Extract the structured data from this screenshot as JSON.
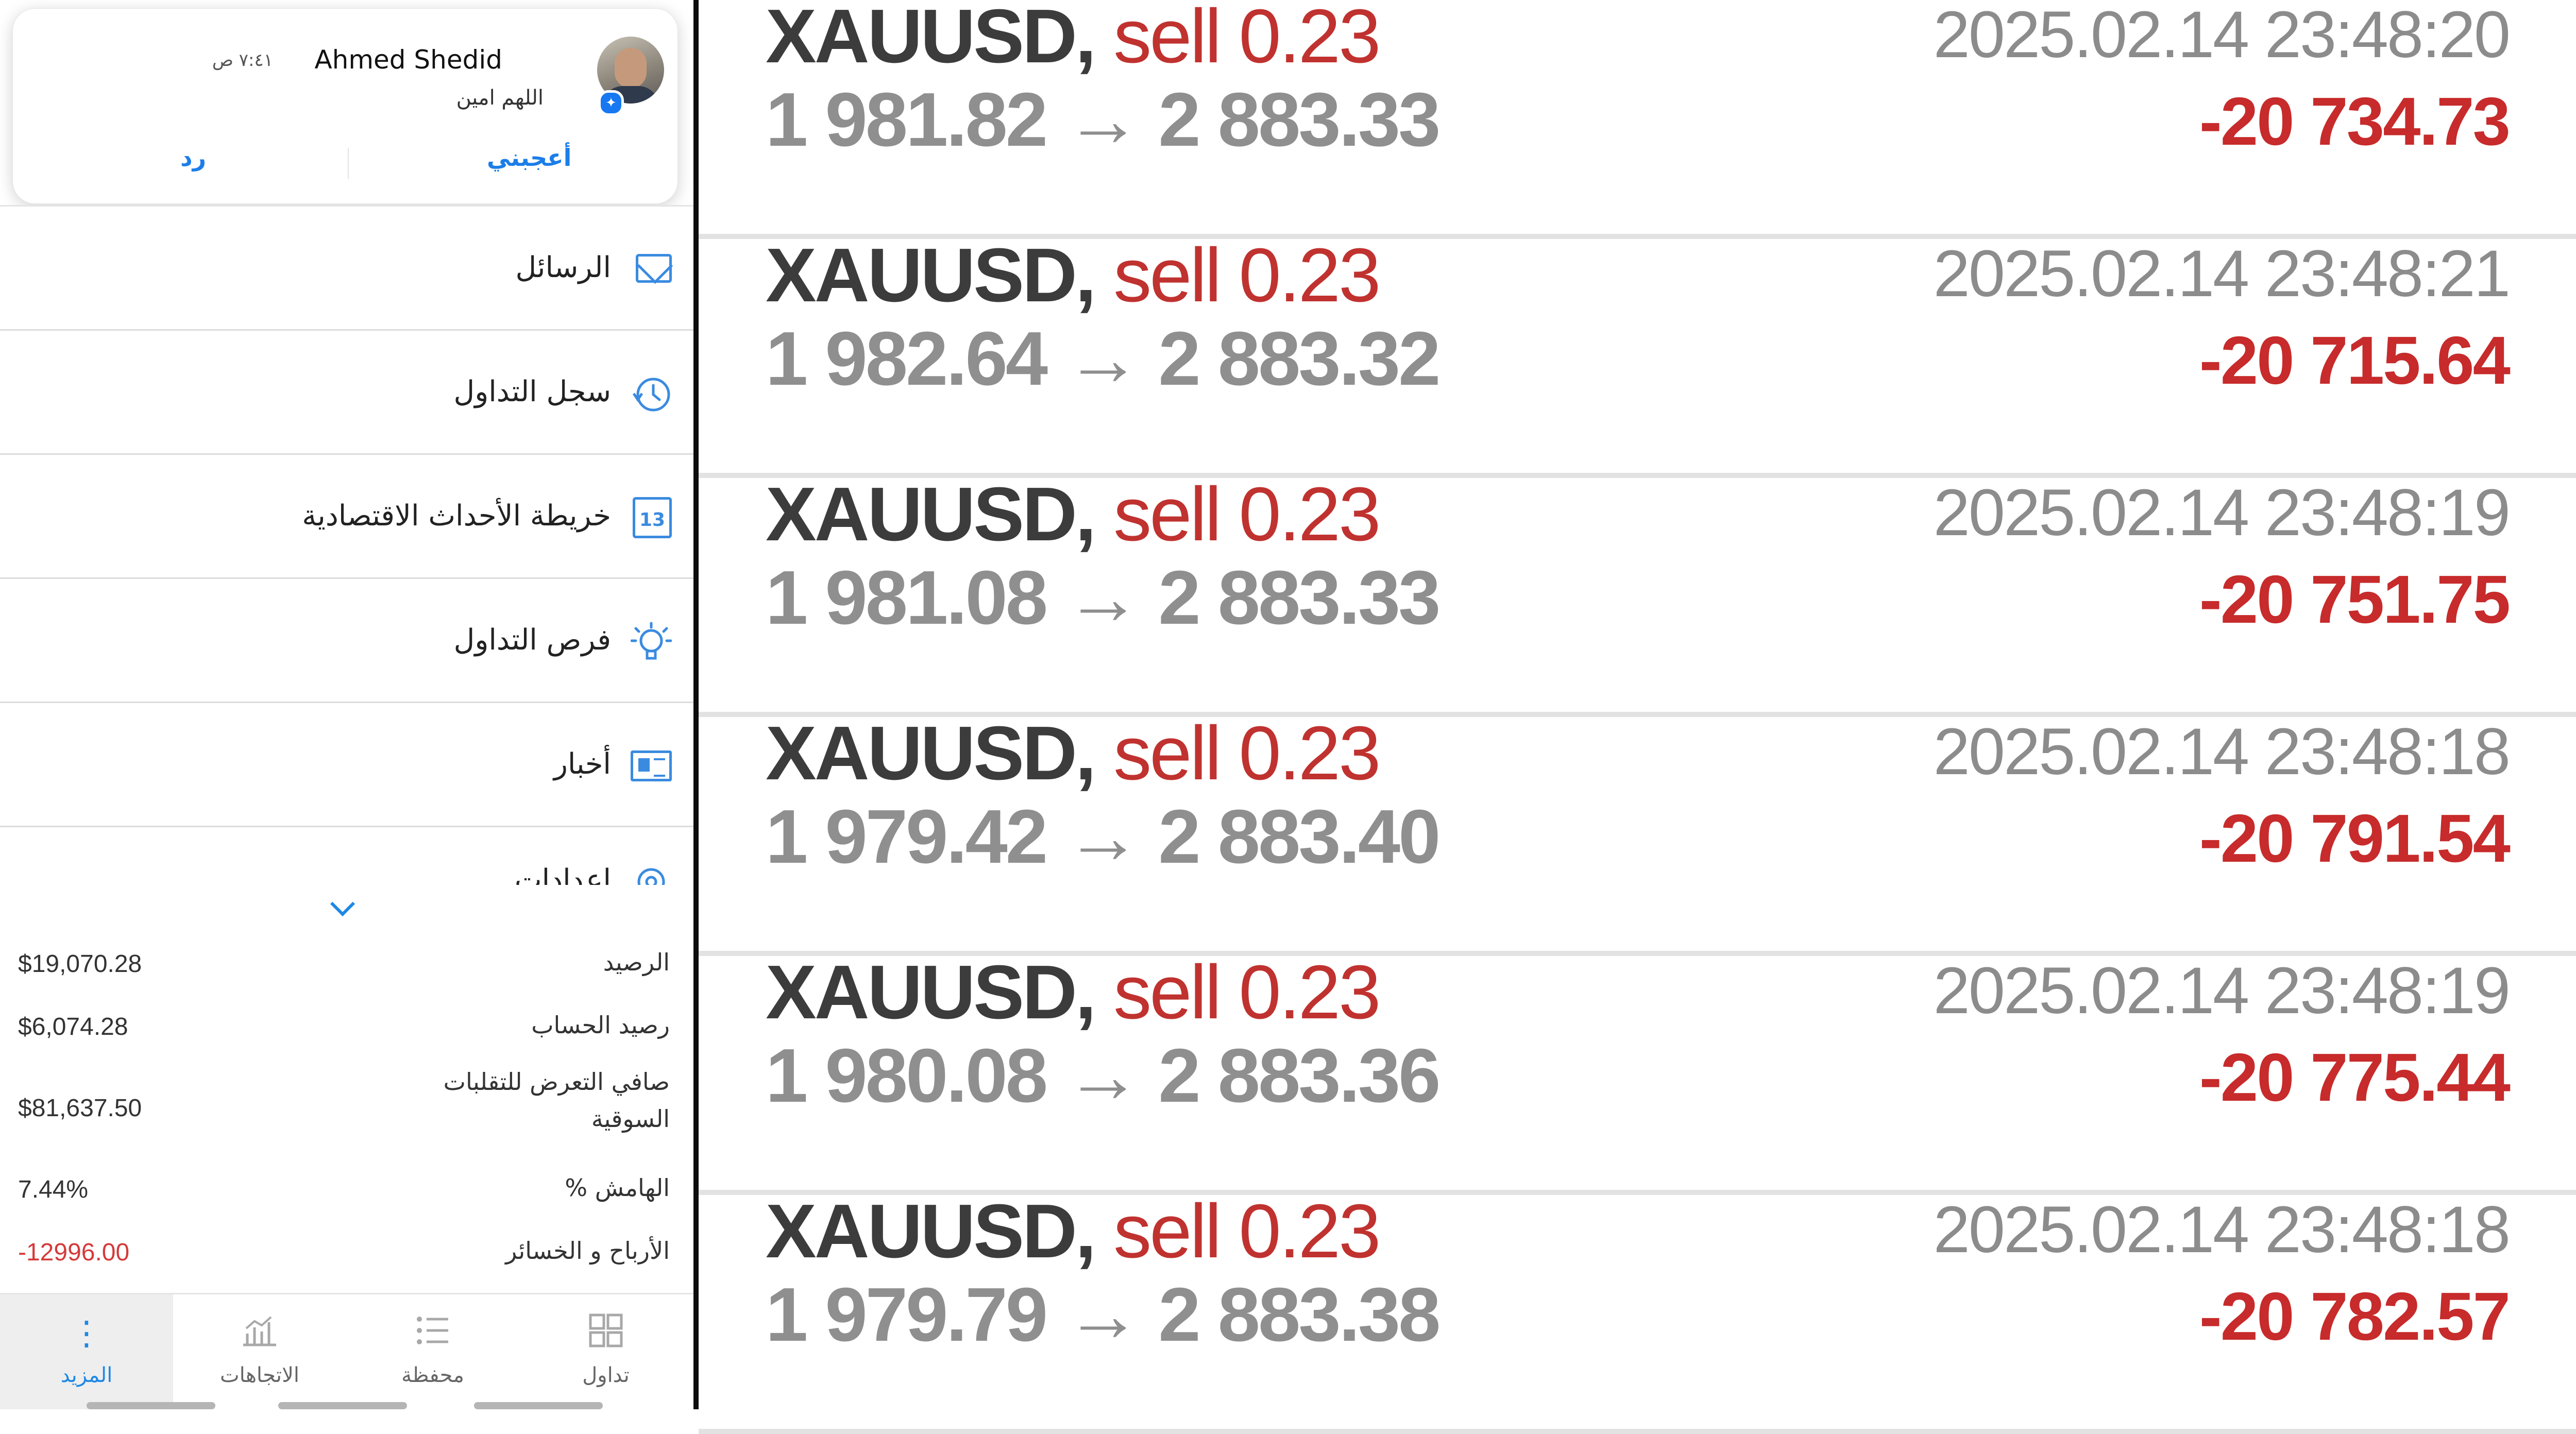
{
  "notification": {
    "name": "Ahmed Shedid",
    "time": "٧:٤١ ص",
    "message": "اللهم امين",
    "like_label": "أعجبني",
    "reply_label": "رد"
  },
  "menu": {
    "items": [
      {
        "label": "الرسائل",
        "icon": "mail-icon"
      },
      {
        "label": "سجل التداول",
        "icon": "history-icon"
      },
      {
        "label": "خريطة الأحداث الاقتصادية",
        "icon": "calendar-icon",
        "icon_text": "13"
      },
      {
        "label": "فرص التداول",
        "icon": "lightbulb-icon"
      },
      {
        "label": "أخبار",
        "icon": "news-icon"
      },
      {
        "label": "إعدادات",
        "icon": "gear-icon"
      }
    ]
  },
  "account": {
    "balance_label": "الرصيد",
    "balance_value": "$19,070.28",
    "equity_label": "رصيد الحساب",
    "equity_value": "$6,074.28",
    "exposure_label": "صافي التعرض للتقلبات السوقية",
    "exposure_value": "$81,637.50",
    "margin_label": "الهامش %",
    "margin_value": "7.44%",
    "pnl_label": "الأرباح و الخسائر",
    "pnl_value": "-12996.00"
  },
  "tabs": [
    {
      "label": "المزيد",
      "icon": "more-icon",
      "active": true
    },
    {
      "label": "الاتجاهات",
      "icon": "trends-icon",
      "active": false
    },
    {
      "label": "محفظة",
      "icon": "portfolio-icon",
      "active": false
    },
    {
      "label": "تداول",
      "icon": "trade-icon",
      "active": false
    }
  ],
  "colors": {
    "accent": "#1e88e5",
    "sell": "#c0322f",
    "loss": "#c72b2b"
  },
  "trades": [
    {
      "symbol": "XAUUSD,",
      "type": "sell 0.23",
      "price": "1 981.82 → 2 883.33",
      "date": "2025.02.14 23:48:20",
      "profit": "-20 734.73"
    },
    {
      "symbol": "XAUUSD,",
      "type": "sell 0.23",
      "price": "1 982.64 → 2 883.32",
      "date": "2025.02.14 23:48:21",
      "profit": "-20 715.64"
    },
    {
      "symbol": "XAUUSD,",
      "type": "sell 0.23",
      "price": "1 981.08 → 2 883.33",
      "date": "2025.02.14 23:48:19",
      "profit": "-20 751.75"
    },
    {
      "symbol": "XAUUSD,",
      "type": "sell 0.23",
      "price": "1 979.42 → 2 883.40",
      "date": "2025.02.14 23:48:18",
      "profit": "-20 791.54"
    },
    {
      "symbol": "XAUUSD,",
      "type": "sell 0.23",
      "price": "1 980.08 → 2 883.36",
      "date": "2025.02.14 23:48:19",
      "profit": "-20 775.44"
    },
    {
      "symbol": "XAUUSD,",
      "type": "sell 0.23",
      "price": "1 979.79 → 2 883.38",
      "date": "2025.02.14 23:48:18",
      "profit": "-20 782.57"
    }
  ]
}
